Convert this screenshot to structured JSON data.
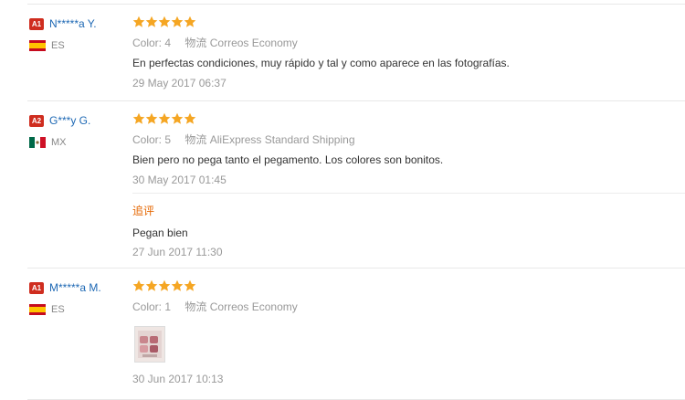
{
  "reviews": [
    {
      "level": "A1",
      "name": "N*****a Y.",
      "country": "ES",
      "flag": "spain-flag-icon",
      "rating": 5,
      "color": "Color: 4",
      "logistics_label": "物流",
      "logistics": "Correos Economy",
      "text": "En perfectas condiciones, muy rápido y tal y como aparece en las fotografías.",
      "date": "29 May 2017 06:37"
    },
    {
      "level": "A2",
      "name": "G***y G.",
      "country": "MX",
      "flag": "mexico-flag-icon",
      "rating": 5,
      "color": "Color: 5",
      "logistics_label": "物流",
      "logistics": "AliExpress Standard Shipping",
      "text": "Bien pero no pega tanto el pegamento. Los colores son bonitos.",
      "date": "30 May 2017 01:45",
      "followup": {
        "label": "追评",
        "text": "Pegan bien",
        "date": "27 Jun 2017 11:30"
      }
    },
    {
      "level": "A1",
      "name": "M*****a M.",
      "country": "ES",
      "flag": "spain-flag-icon",
      "rating": 5,
      "color": "Color: 1",
      "logistics_label": "物流",
      "logistics": "Correos Economy",
      "date": "30 Jun 2017 10:13"
    }
  ],
  "colors": {
    "star": "#f5a623",
    "name": "#1d68b4",
    "level": "#cf2d1f",
    "followup": "#e56600"
  }
}
